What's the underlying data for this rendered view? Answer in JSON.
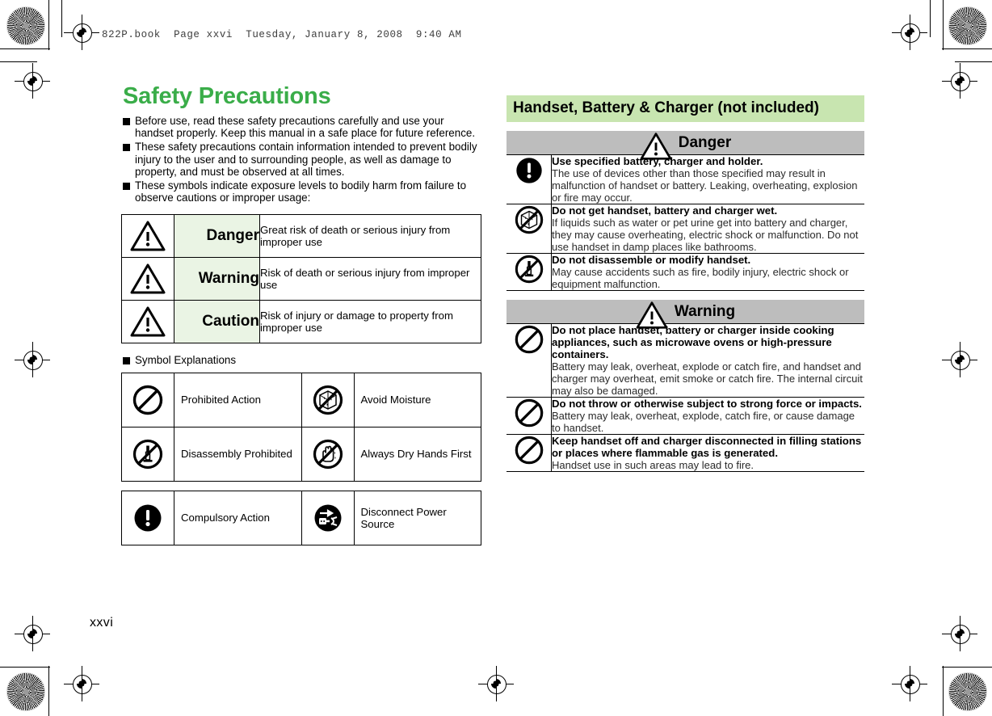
{
  "print_slug": "822P.book  Page xxvi  Tuesday, January 8, 2008  9:40 AM",
  "folio": "xxvi",
  "colors": {
    "title_green": "#3aad49",
    "banner_green": "#c8e5b0",
    "label_green": "#eaf4e4",
    "level_gray": "#bdbdbd"
  },
  "left": {
    "title": "Safety Precautions",
    "bullets": [
      "Before use, read these safety precautions carefully and use your handset properly. Keep this manual in a safe place for future reference.",
      "These safety precautions contain information intended to prevent bodily injury to the user and to surrounding people, as well as damage to property, and must be observed at all times.",
      "These symbols indicate exposure levels to bodily harm from failure to observe cautions or improper usage:"
    ],
    "levels": [
      {
        "icon": "warning-triangle-icon",
        "label": "Danger",
        "desc": "Great risk of death or serious injury from improper use"
      },
      {
        "icon": "warning-triangle-icon",
        "label": "Warning",
        "desc": "Risk of death or serious injury from improper use"
      },
      {
        "icon": "warning-triangle-icon",
        "label": "Caution",
        "desc": "Risk of injury or damage to property from improper use"
      }
    ],
    "symbols_heading": "Symbol Explanations",
    "symbols_group_1": [
      {
        "icon_left": "prohibited-icon",
        "label_left": "Prohibited Action",
        "icon_right": "no-moisture-icon",
        "label_right": "Avoid Moisture"
      },
      {
        "icon_left": "no-disassembly-icon",
        "label_left": "Disassembly Prohibited",
        "icon_right": "dry-hands-icon",
        "label_right": "Always Dry Hands First"
      }
    ],
    "symbols_group_2": [
      {
        "icon_left": "compulsory-icon",
        "label_left": "Compulsory Action",
        "icon_right": "unplug-icon",
        "label_right": "Disconnect Power Source"
      }
    ]
  },
  "right": {
    "section_title": "Handset, Battery & Charger (not included)",
    "levels": [
      {
        "name": "Danger",
        "icon": "warning-triangle-icon",
        "notes": [
          {
            "icon": "compulsory-icon",
            "head": "Use specified battery, charger and holder.",
            "text": "The use of devices other than those specified may result in malfunction of handset or battery. Leaking, overheating, explosion or fire may occur."
          },
          {
            "icon": "no-moisture-icon",
            "head": "Do not get handset, battery and charger wet.",
            "text": "If liquids such as water or pet urine get into battery and charger, they may cause overheating, electric shock or malfunction. Do not use handset in damp places like bathrooms."
          },
          {
            "icon": "no-disassembly-icon",
            "head": "Do not disassemble or modify handset.",
            "text": "May cause accidents such as fire, bodily injury, electric shock or equipment malfunction."
          }
        ]
      },
      {
        "name": "Warning",
        "icon": "warning-triangle-icon",
        "notes": [
          {
            "icon": "prohibited-icon",
            "head": "Do not place handset, battery or charger inside cooking appliances, such as microwave ovens or high-pressure containers.",
            "text": "Battery may leak, overheat, explode or catch fire, and handset and charger may overheat, emit smoke or catch fire. The internal circuit may also be damaged."
          },
          {
            "icon": "prohibited-icon",
            "head": "Do not throw or otherwise subject to strong force or impacts.",
            "text": "Battery may leak, overheat, explode, catch fire, or cause damage to handset."
          },
          {
            "icon": "prohibited-icon",
            "head": "Keep handset off and charger disconnected in filling stations or places where flammable gas is generated.",
            "text": "Handset use in such areas may lead to fire."
          }
        ]
      }
    ]
  }
}
